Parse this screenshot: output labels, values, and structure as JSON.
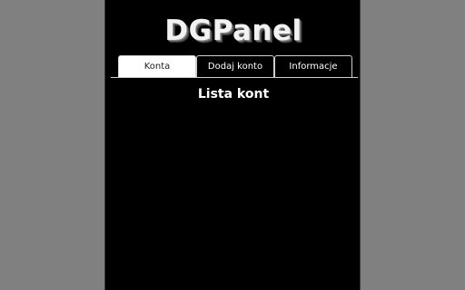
{
  "app": {
    "logo_text": "DGPanel"
  },
  "tabs": [
    {
      "label": "Konta",
      "active": true
    },
    {
      "label": "Dodaj konto",
      "active": false
    },
    {
      "label": "Informacje",
      "active": false
    }
  ],
  "main": {
    "section_title": "Lista kont"
  },
  "colors": {
    "page_background": "#808080",
    "panel_background": "#000000",
    "active_tab_background": "#ffffff",
    "text": "#ffffff"
  }
}
